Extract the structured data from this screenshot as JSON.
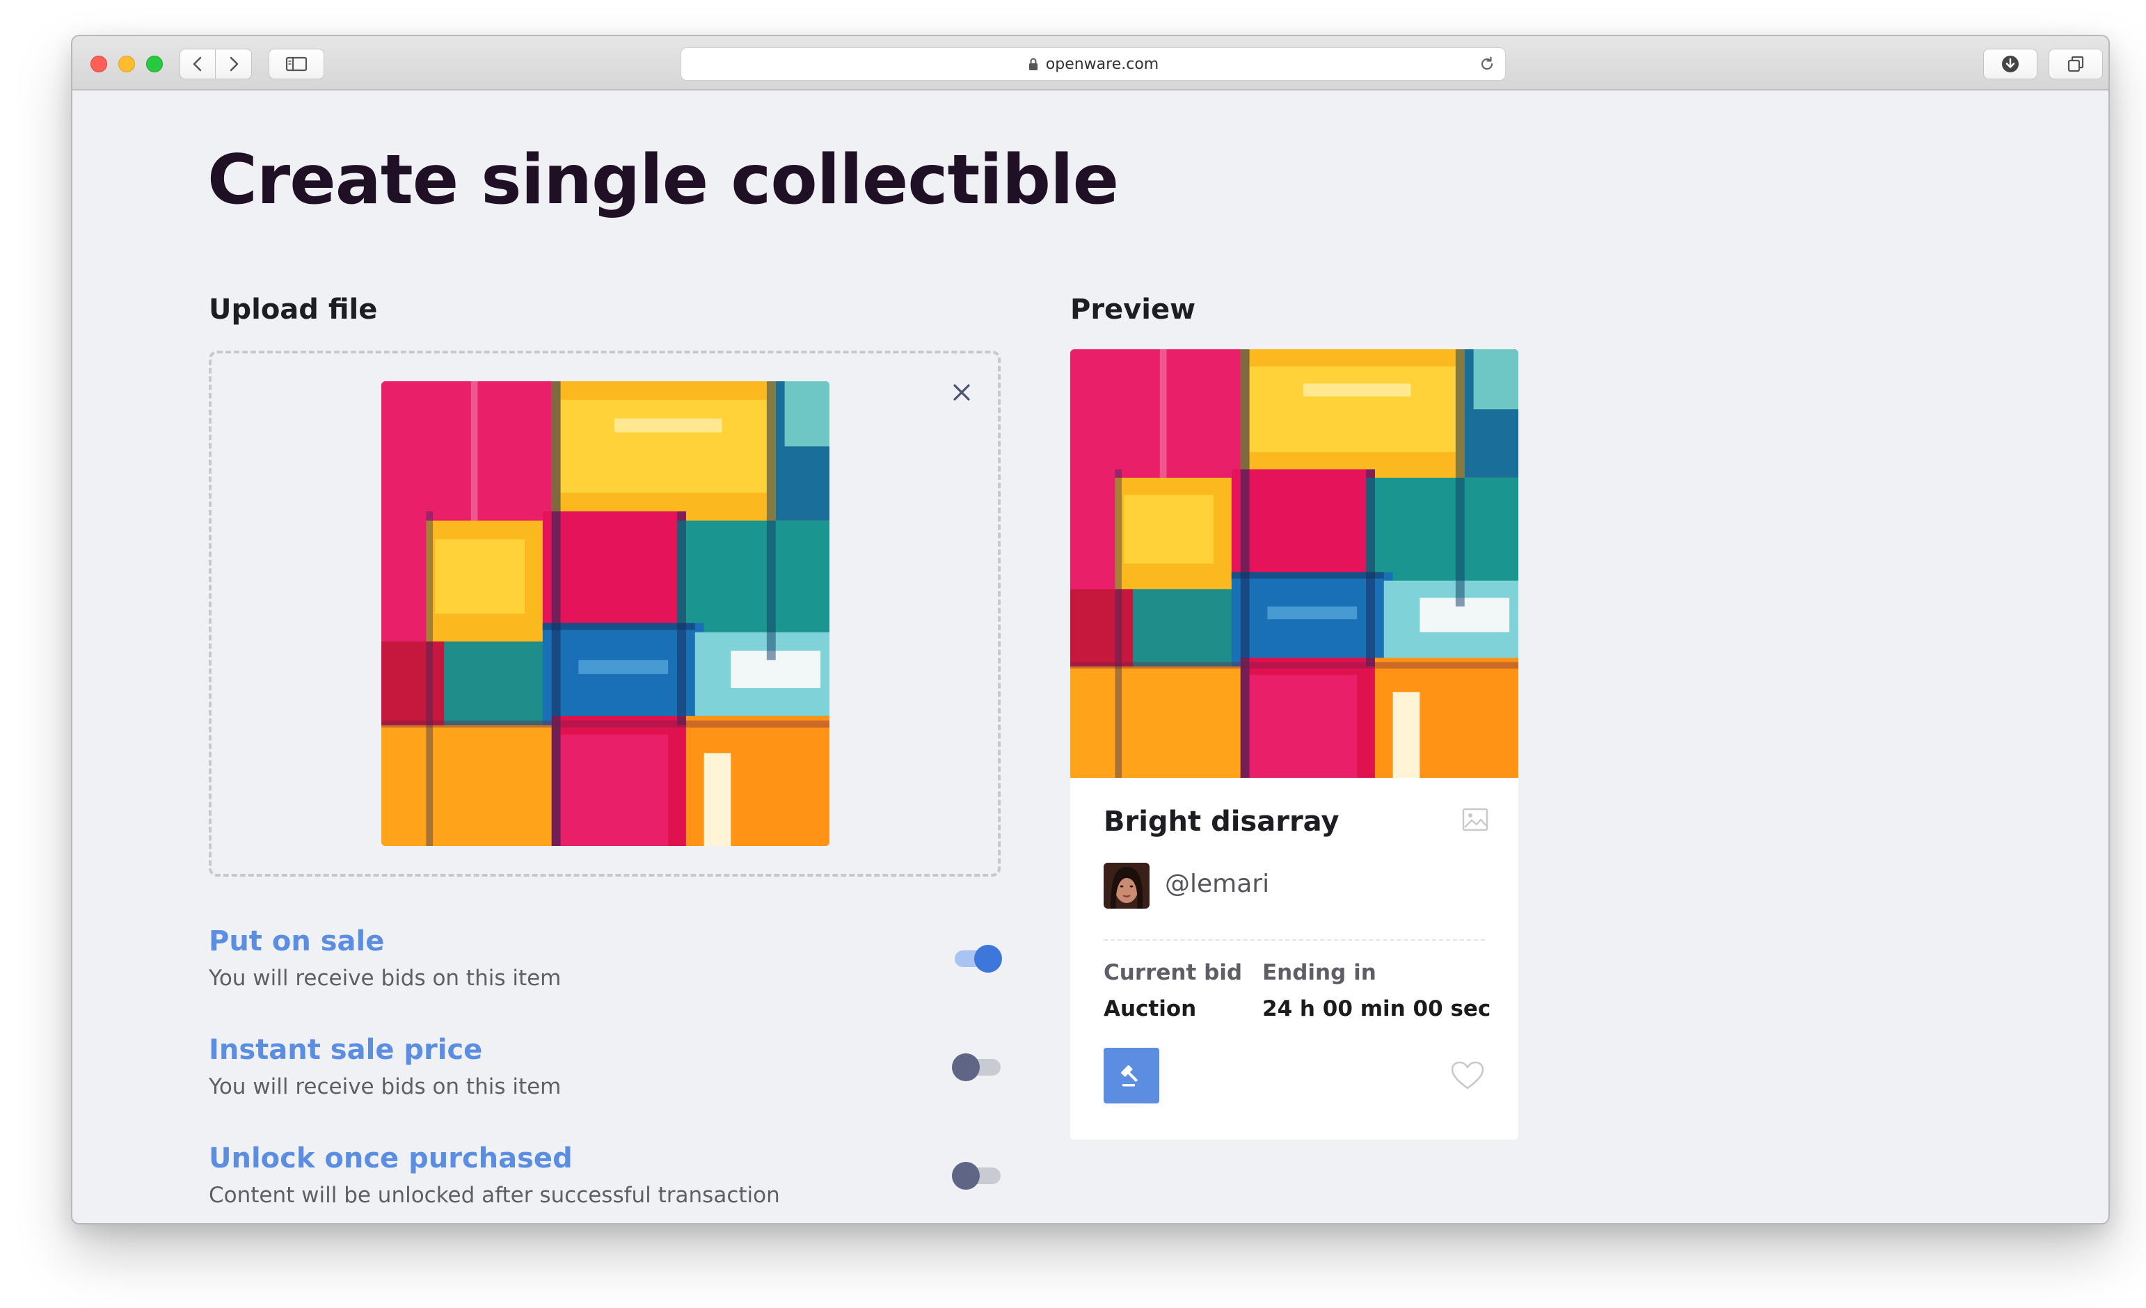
{
  "browser": {
    "url": "openware.com"
  },
  "page": {
    "title": "Create single collectible"
  },
  "upload": {
    "label": "Upload file"
  },
  "preview": {
    "label": "Preview",
    "card": {
      "title": "Bright disarray",
      "creator": "@lemari",
      "current_bid_label": "Current bid",
      "current_bid_value": "Auction",
      "ending_label": "Ending in",
      "ending_value": "24 h 00 min 00 sec"
    }
  },
  "options": [
    {
      "title": "Put on sale",
      "description": "You will receive bids on this item",
      "enabled": true
    },
    {
      "title": "Instant sale price",
      "description": "You will receive bids on this item",
      "enabled": false
    },
    {
      "title": "Unlock once purchased",
      "description": "Content will be unlocked after successful transaction",
      "enabled": false
    }
  ],
  "colors": {
    "accent": "#5b8ee0",
    "toggle_on": "#3d77db",
    "toggle_off": "#5f6584",
    "title_text": "#1f1026"
  },
  "icons": {
    "close": "close-icon",
    "bid": "auction-hammer-icon",
    "like": "heart-icon",
    "media": "image-icon"
  }
}
